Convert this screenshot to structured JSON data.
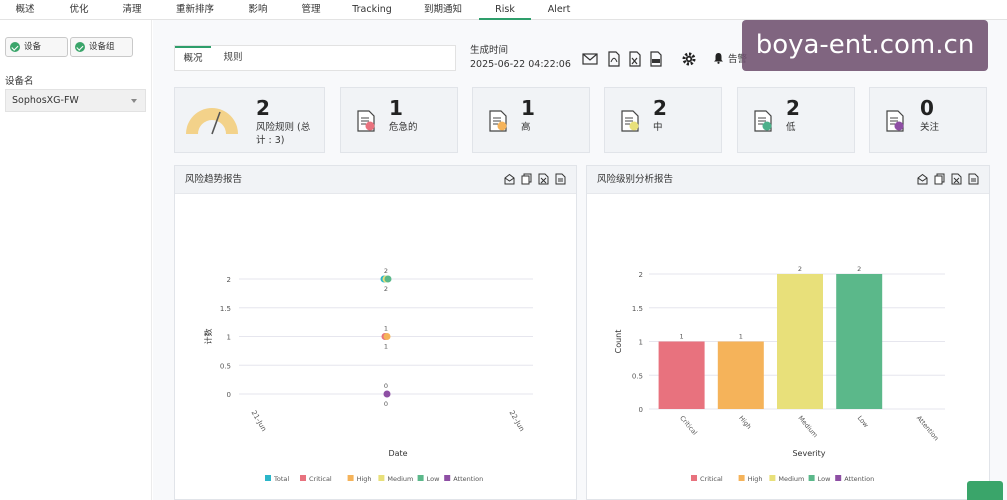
{
  "top_nav": {
    "tabs": [
      {
        "label": "概述"
      },
      {
        "label": "优化"
      },
      {
        "label": "清理"
      },
      {
        "label": "重新排序"
      },
      {
        "label": "影响"
      },
      {
        "label": "管理"
      },
      {
        "label": "Tracking"
      },
      {
        "label": "到期通知"
      },
      {
        "label": "Risk",
        "active": true
      },
      {
        "label": "Alert"
      }
    ]
  },
  "sidebar": {
    "device_button": "设备",
    "device_group_button": "设备组",
    "device_name_label": "设备名",
    "device_select_value": "SophosXG-FW"
  },
  "subtabs": [
    {
      "label": "概况",
      "active": true
    },
    {
      "label": "规则"
    }
  ],
  "generated": {
    "label": "生成时间",
    "value": "2025-06-22 04:22:06"
  },
  "toolbar": {
    "alarm_label": "告警"
  },
  "summary_cards": [
    {
      "value": "2",
      "caption": "风险规则 (总计 : 3)",
      "gauge": true
    },
    {
      "value": "1",
      "caption": "危急的",
      "dot_color": "#e8727e"
    },
    {
      "value": "1",
      "caption": "高",
      "dot_color": "#f5b35a"
    },
    {
      "value": "2",
      "caption": "中",
      "dot_color": "#e8e07a"
    },
    {
      "value": "2",
      "caption": "低",
      "dot_color": "#4db08a"
    },
    {
      "value": "0",
      "caption": "关注",
      "dot_color": "#8e4fa4"
    }
  ],
  "watermark": "boya-ent.com.cn",
  "colors": {
    "Total": "#2bb6c9",
    "Critical": "#e8727e",
    "High": "#f5b35a",
    "Medium": "#e8e07a",
    "Low": "#5bb88a",
    "Attention": "#8e4fa4"
  },
  "chart_data": [
    {
      "type": "scatter",
      "title": "风险趋势报告",
      "xlabel": "Date",
      "ylabel": "计数",
      "x_ticks": [
        "21-Jun",
        "22-Jun"
      ],
      "y_ticks": [
        "0",
        "0.5",
        "1",
        "1.5",
        "2"
      ],
      "ylim": [
        0,
        2
      ],
      "series": [
        {
          "name": "Total",
          "values": [
            {
              "x": "22-Jun",
              "y": 2
            }
          ]
        },
        {
          "name": "Critical",
          "values": [
            {
              "x": "22-Jun",
              "y": 1
            }
          ]
        },
        {
          "name": "High",
          "values": [
            {
              "x": "22-Jun",
              "y": 1
            }
          ]
        },
        {
          "name": "Medium",
          "values": [
            {
              "x": "22-Jun",
              "y": 2
            }
          ]
        },
        {
          "name": "Low",
          "values": [
            {
              "x": "22-Jun",
              "y": 2
            }
          ]
        },
        {
          "name": "Attention",
          "values": [
            {
              "x": "22-Jun",
              "y": 0
            }
          ]
        }
      ],
      "legend": [
        "Total",
        "Critical",
        "High",
        "Medium",
        "Low",
        "Attention"
      ],
      "legend_position": "bottom"
    },
    {
      "type": "bar",
      "title": "风险级别分析报告",
      "xlabel": "Severity",
      "ylabel": "Count",
      "categories": [
        "Critical",
        "High",
        "Medium",
        "Low",
        "Attention"
      ],
      "values": [
        1,
        1,
        2,
        2,
        0
      ],
      "y_ticks": [
        "0",
        "0.5",
        "1",
        "1.5",
        "2"
      ],
      "ylim": [
        0,
        2
      ],
      "legend": [
        "Critical",
        "High",
        "Medium",
        "Low",
        "Attention"
      ],
      "legend_position": "bottom"
    }
  ]
}
